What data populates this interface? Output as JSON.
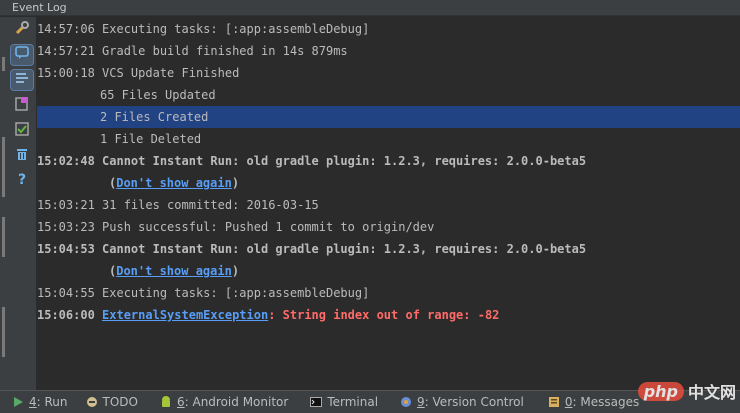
{
  "window": {
    "title": "Event Log"
  },
  "toolbar": {
    "icons": [
      "settings-icon",
      "chat-icon",
      "filter-icon",
      "mark-icon",
      "checklist-icon",
      "trash-icon",
      "help-icon"
    ]
  },
  "log": {
    "lines": [
      {
        "time": "14:57:06",
        "text": " Executing tasks: [:app:assembleDebug]"
      },
      {
        "time": "14:57:21",
        "text": " Gradle build finished in 14s 879ms"
      },
      {
        "time": "15:00:18",
        "text": " VCS Update Finished"
      },
      {
        "time": "",
        "text": "65 Files Updated"
      },
      {
        "time": "",
        "text": "2 Files Created"
      },
      {
        "time": "",
        "text": "1 File Deleted"
      },
      {
        "time": "15:02:48",
        "text": " Cannot Instant Run: old gradle plugin: 1.2.3, requires: 2.0.0-beta5"
      },
      {
        "time": "",
        "text": "Don't show again"
      },
      {
        "time": "15:03:21",
        "text": " 31 files committed: 2016-03-15"
      },
      {
        "time": "15:03:23",
        "text": " Push successful: Pushed 1 commit to origin/dev"
      },
      {
        "time": "15:04:53",
        "text": " Cannot Instant Run: old gradle plugin: 1.2.3, requires: 2.0.0-beta5"
      },
      {
        "time": "",
        "text": "Don't show again"
      },
      {
        "time": "15:04:55",
        "text": " Executing tasks: [:app:assembleDebug]"
      },
      {
        "time": "15:06:00",
        "text": "ExternalSystemException",
        "error": ": String index out of range: -82"
      }
    ]
  },
  "statusbar": {
    "tabs": [
      {
        "num": "4",
        "label": ": Run"
      },
      {
        "num": "",
        "label": "TODO"
      },
      {
        "num": "6",
        "label": ": Android Monitor"
      },
      {
        "num": "",
        "label": "Terminal"
      },
      {
        "num": "9",
        "label": ": Version Control"
      },
      {
        "num": "0",
        "label": ": Messages"
      }
    ]
  },
  "watermark": {
    "brand": "php",
    "suffix": "中文网"
  },
  "colors": {
    "background": "#2b2b2b",
    "selection": "#214283",
    "link": "#589df6",
    "error": "#ff6b68"
  }
}
